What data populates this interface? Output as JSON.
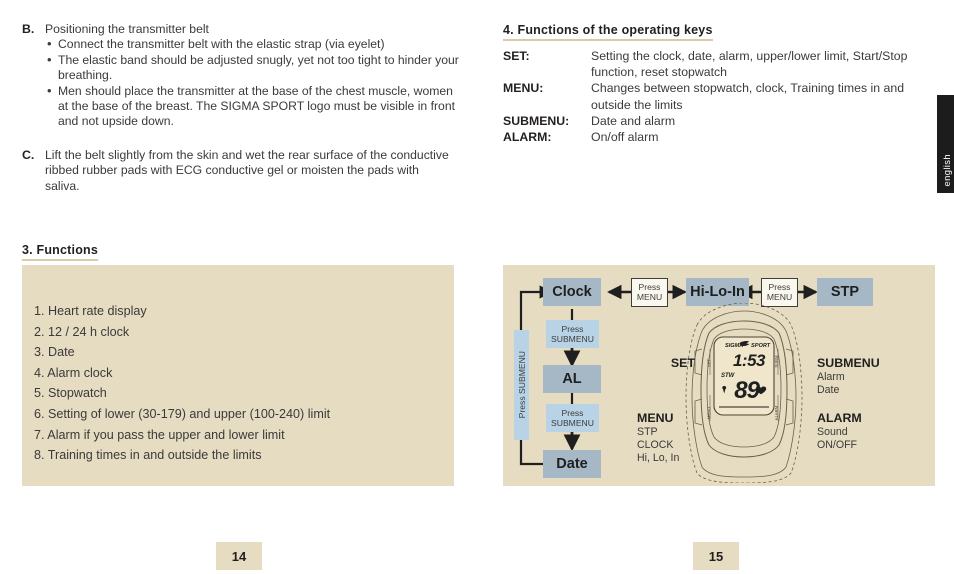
{
  "left_page": {
    "page_number": "14",
    "section_b": {
      "letter": "B.",
      "title": "Positioning the transmitter belt",
      "bullets": [
        "Connect the transmitter belt with the elastic strap (via eyelet)",
        "The elastic band should be adjusted snugly, yet not too tight to hinder your breathing.",
        "Men should place the transmitter at the base of the chest muscle, women at the base of the breast. The SIGMA SPORT logo must be visible in front and not upside down."
      ]
    },
    "section_c": {
      "letter": "C.",
      "text": "Lift the belt slightly from the skin and wet the rear surface of the conductive ribbed rubber pads with ECG conductive gel or moisten the pads with saliva."
    },
    "functions": {
      "heading": "3. Functions",
      "items": [
        "1. Heart rate display",
        "2. 12 / 24 h clock",
        "3. Date",
        "4. Alarm clock",
        "5. Stopwatch",
        "6. Setting of lower (30-179) and upper (100-240) limit",
        "7. Alarm if you pass the upper and lower limit",
        "8. Training times in and outside the limits"
      ]
    }
  },
  "right_page": {
    "page_number": "15",
    "heading": "4. Functions of the operating keys",
    "keys": [
      {
        "name": "SET:",
        "desc": "Setting the clock, date, alarm, upper/lower limit, Start/Stop function, reset stopwatch"
      },
      {
        "name": "MENU:",
        "desc": "Changes between stopwatch, clock, Training times in and outside the limits"
      },
      {
        "name": "SUBMENU:",
        "desc": "Date and alarm"
      },
      {
        "name": "ALARM:",
        "desc": "On/off alarm"
      }
    ],
    "language_tab": "english",
    "diagram": {
      "boxes": {
        "clock": "Clock",
        "hilo": "Hi-Lo-In",
        "stp": "STP",
        "al": "AL",
        "date": "Date"
      },
      "press_menu_1": {
        "line1": "Press",
        "line2": "MENU"
      },
      "press_menu_2": {
        "line1": "Press",
        "line2": "MENU"
      },
      "press_submenu_1": {
        "line1": "Press",
        "line2": "SUBMENU"
      },
      "press_submenu_2": {
        "line1": "Press",
        "line2": "SUBMENU"
      },
      "press_submenu_loop": "Press SUBMENU",
      "watch": {
        "brand_left": "SIGMA",
        "brand_right": "SPORT",
        "time": "1:53",
        "stw": "STW",
        "heart_rate": "89",
        "side_left_top": "SET",
        "side_left_bottom": "MENU",
        "side_right_top": "SUBMENU",
        "side_right_bottom": "ALARM"
      },
      "labels": {
        "set": {
          "title": "SET"
        },
        "menu": {
          "title": "MENU",
          "l1": "STP",
          "l2": "CLOCK",
          "l3": "Hi, Lo, In"
        },
        "submenu": {
          "title": "SUBMENU",
          "l1": "Alarm",
          "l2": "Date"
        },
        "alarm": {
          "title": "ALARM",
          "l1": "Sound",
          "l2": "ON/OFF"
        }
      }
    }
  },
  "colors": {
    "tan_panel": "#e5dcc1",
    "flow_box": "#a6b8c6",
    "press_submenu": "#b8d3e6",
    "heading_rule": "#d9cba8"
  }
}
